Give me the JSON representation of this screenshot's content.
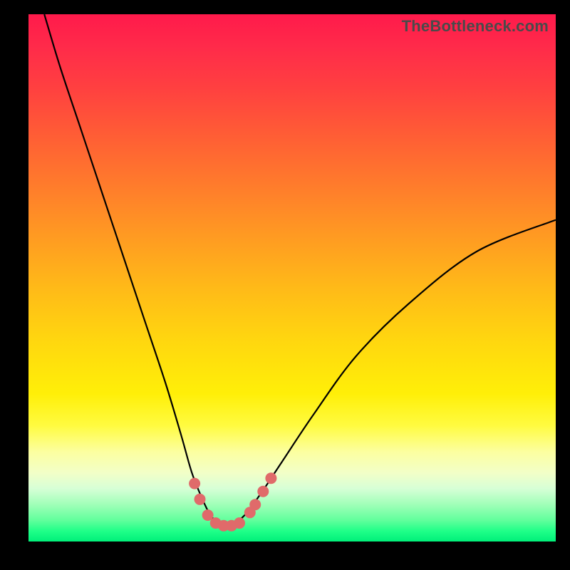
{
  "watermark": "TheBottleneck.com",
  "colors": {
    "dot": "#e06a6a",
    "curve": "#000000",
    "frame": "#000000"
  },
  "chart_data": {
    "type": "line",
    "title": "",
    "xlabel": "",
    "ylabel": "",
    "xlim": [
      0,
      100
    ],
    "ylim": [
      0,
      100
    ],
    "grid": false,
    "legend": false,
    "series": [
      {
        "name": "bottleneck-curve",
        "x": [
          3,
          6,
          10,
          14,
          18,
          22,
          26,
          29,
          31,
          33,
          34.5,
          36,
          37.5,
          39,
          41,
          44,
          48,
          54,
          62,
          72,
          85,
          100
        ],
        "y": [
          100,
          90,
          78,
          66,
          54,
          42,
          30,
          20,
          13,
          8,
          5,
          3.5,
          3,
          3.5,
          5,
          9,
          15,
          24,
          35,
          45,
          55,
          61
        ]
      }
    ],
    "points": [
      {
        "x": 31.5,
        "y": 11
      },
      {
        "x": 32.5,
        "y": 8
      },
      {
        "x": 34.0,
        "y": 5
      },
      {
        "x": 35.5,
        "y": 3.5
      },
      {
        "x": 37.0,
        "y": 3
      },
      {
        "x": 38.5,
        "y": 3
      },
      {
        "x": 40.0,
        "y": 3.5
      },
      {
        "x": 42.0,
        "y": 5.5
      },
      {
        "x": 43.0,
        "y": 7
      },
      {
        "x": 44.5,
        "y": 9.5
      },
      {
        "x": 46.0,
        "y": 12
      }
    ]
  }
}
